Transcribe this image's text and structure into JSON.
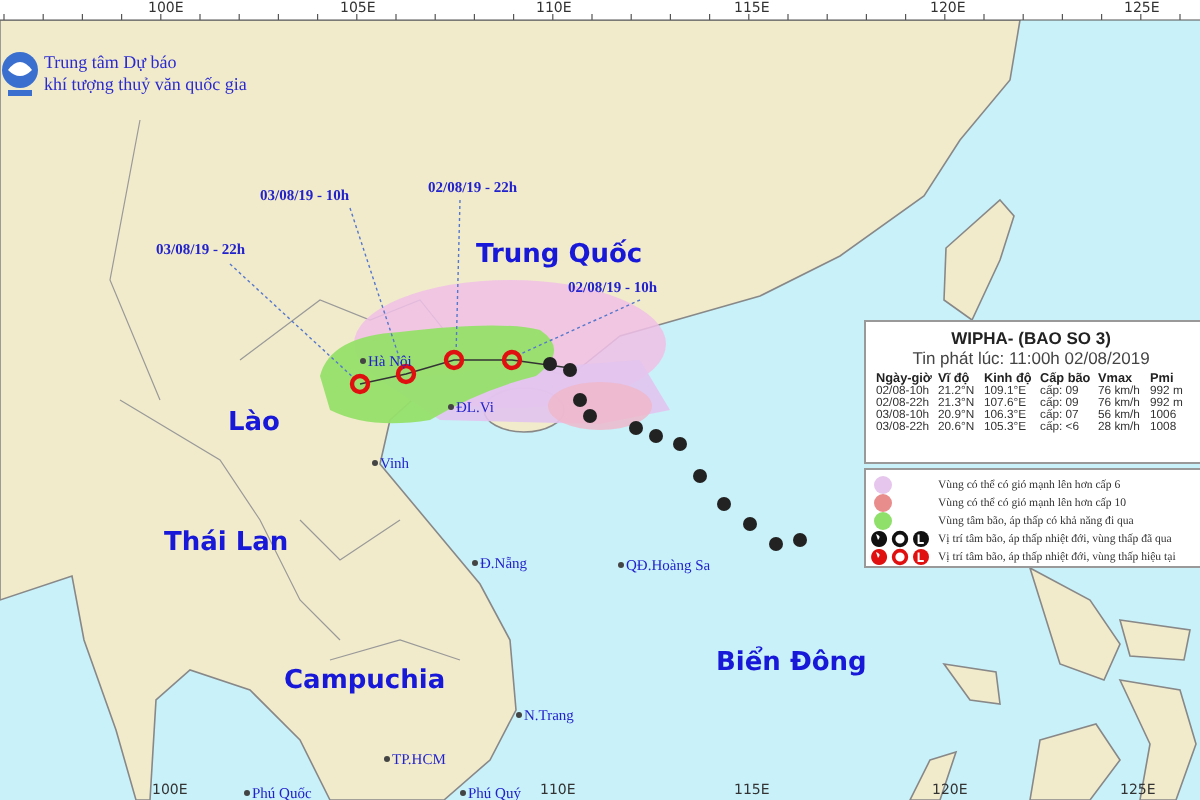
{
  "agency": {
    "line_1": "Trung tâm Dự báo",
    "line_2": "khí tượng thuỷ văn quốc gia"
  },
  "top_ticks": [
    "100E",
    "105E",
    "110E",
    "115E",
    "120E",
    "125E"
  ],
  "bottom_ticks": [
    "100E",
    "110E",
    "115E",
    "120E",
    "125E"
  ],
  "countries": [
    "Trung Quốc",
    "Lào",
    "Thái Lan",
    "Campuchia",
    "Biển Đông"
  ],
  "places": [
    "Hà Nội",
    "ĐL.Vi",
    "Vinh",
    "Đ.Nẵng",
    "QĐ.Hoàng Sa",
    "N.Trang",
    "TP.HCM",
    "Phú Quốc",
    "Phú Quý"
  ],
  "forecast_labels": [
    "03/08/19 - 10h",
    "02/08/19 - 22h",
    "03/08/19 - 22h",
    "02/08/19 - 10h"
  ],
  "storm_info": {
    "title": "WIPHA- (BAO SO 3)",
    "issued": "Tin phát lúc: 11:00h 02/08/2019",
    "columns": [
      "Ngày-giờ",
      "Vĩ độ",
      "Kinh độ",
      "Cấp bão",
      "Vmax",
      "Pmi"
    ],
    "rows": [
      [
        "02/08-10h",
        "21.2°N",
        "109.1°E",
        "cấp: 09",
        "76 km/h",
        "992 m"
      ],
      [
        "02/08-22h",
        "21.3°N",
        "107.6°E",
        "cấp: 09",
        "76 km/h",
        "992 m"
      ],
      [
        "03/08-10h",
        "20.9°N",
        "106.3°E",
        "cấp: 07",
        "56 km/h",
        "1006"
      ],
      [
        "03/08-22h",
        "20.6°N",
        "105.3°E",
        "cấp: <6",
        "28 km/h",
        "1008"
      ]
    ]
  },
  "legend": [
    {
      "kind": "zone",
      "color": "#e6c6ec",
      "text": "Vùng có thể có gió mạnh lên hơn cấp 6"
    },
    {
      "kind": "zone",
      "color": "#e88c8c",
      "text": "Vùng có thể có gió mạnh lên hơn cấp 10"
    },
    {
      "kind": "zone",
      "color": "#8ee06a",
      "text": "Vùng tâm bão, áp thấp có khả năng đi qua"
    },
    {
      "kind": "past",
      "text": "Vị trí tâm bão, áp thấp nhiệt đới, vùng thấp đã qua"
    },
    {
      "kind": "forecast",
      "text": "Vị trí tâm bão, áp thấp nhiệt đới, vùng thấp hiệu tại"
    }
  ]
}
